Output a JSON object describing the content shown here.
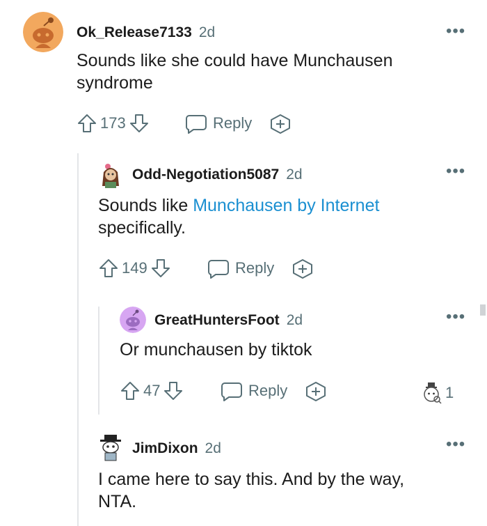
{
  "comments": [
    {
      "username": "Ok_Release7133",
      "age": "2d",
      "text": "Sounds like she could have Munchausen syndrome",
      "score": "173",
      "reply_label": "Reply"
    },
    {
      "username": "Odd-Negotiation5087",
      "age": "2d",
      "text_before": "Sounds like ",
      "link_text": "Munchausen by Internet",
      "text_after": " specifically.",
      "score": "149",
      "reply_label": "Reply"
    },
    {
      "username": "GreatHuntersFoot",
      "age": "2d",
      "text": "Or munchausen by tiktok",
      "score": "47",
      "reply_label": "Reply",
      "award_count": "1"
    },
    {
      "username": "JimDixon",
      "age": "2d",
      "text": "I came here to say this. And by the way, NTA."
    }
  ],
  "more_glyph": "•••",
  "colors": {
    "link": "#1a8fd1",
    "meta": "#576f76",
    "text": "#1c1c1c",
    "thread_line": "#e3e5e8",
    "avatar_orange": "#f2a85e",
    "avatar_purple": "#d7a6f2"
  }
}
